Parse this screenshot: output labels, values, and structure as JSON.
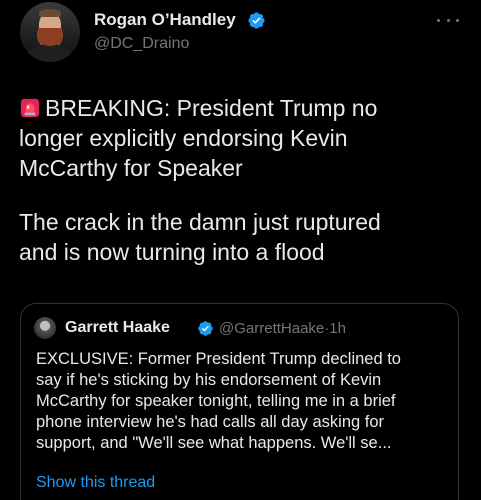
{
  "author": {
    "display_name": "Rogan O’Handley",
    "handle": "@DC_Draino",
    "verified": true
  },
  "tweet": {
    "paragraph1_lines": [
      "BREAKING: President Trump no",
      "longer explicitly endorsing Kevin",
      "McCarthy for Speaker"
    ],
    "paragraph2_lines": [
      "The crack in the damn just ruptured",
      "and is now turning into a flood"
    ],
    "leading_emoji": "siren-icon"
  },
  "quoted_tweet": {
    "display_name": "Garrett Haake",
    "handle": "@GarrettHaake",
    "separator": "·",
    "time": "1h",
    "verified": true,
    "text_lines": [
      "EXCLUSIVE: Former President Trump declined to",
      "say if he's sticking by his endorsement of Kevin",
      "McCarthy for speaker tonight, telling me in a brief",
      "phone interview he's had calls all day asking for",
      "support, and \"We'll see what happens. We'll se..."
    ],
    "show_thread_label": "Show this thread"
  },
  "colors": {
    "background": "#000000",
    "primary_text": "#e7e9ea",
    "secondary_text": "#71767b",
    "accent": "#1d9bf0",
    "border": "#2f3336"
  }
}
